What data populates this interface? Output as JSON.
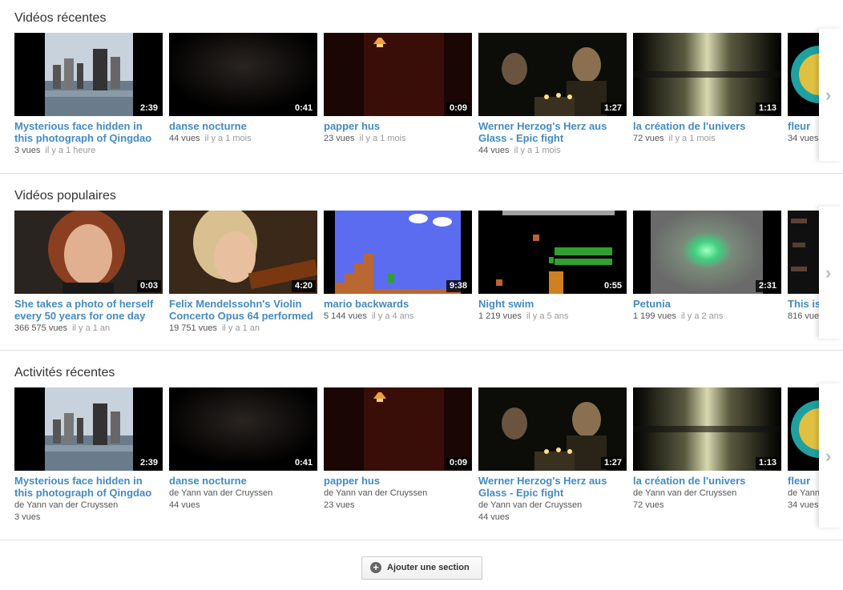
{
  "sections": [
    {
      "title": "Vidéos récentes",
      "videos": [
        {
          "title": "Mysterious face hidden in this photograph of Qingdao",
          "duration": "2:39",
          "views": "3 vues",
          "age": "il y a 1 heure"
        },
        {
          "title": "danse nocturne",
          "duration": "0:41",
          "views": "44 vues",
          "age": "il y a 1 mois"
        },
        {
          "title": "papper hus",
          "duration": "0:09",
          "views": "23 vues",
          "age": "il y a 1 mois"
        },
        {
          "title": "Werner Herzog's Herz aus Glass - Epic fight",
          "duration": "1:27",
          "views": "44 vues",
          "age": "il y a 1 mois"
        },
        {
          "title": "la création de l'univers",
          "duration": "1:13",
          "views": "72 vues",
          "age": "il y a 1 mois"
        },
        {
          "title": "fleur",
          "duration": "",
          "views": "34 vues",
          "age": ""
        }
      ]
    },
    {
      "title": "Vidéos populaires",
      "videos": [
        {
          "title": "She takes a photo of herself every 50 years for one day",
          "duration": "0:03",
          "views": "366 575 vues",
          "age": "il y a 1 an"
        },
        {
          "title": "Felix Mendelssohn's Violin Concerto Opus 64 performed",
          "duration": "4:20",
          "views": "19 751 vues",
          "age": "il y a 1 an"
        },
        {
          "title": "mario backwards",
          "duration": "9:38",
          "views": "5 144 vues",
          "age": "il y a 4 ans"
        },
        {
          "title": "Night swim",
          "duration": "0:55",
          "views": "1 219 vues",
          "age": "il y a 5 ans"
        },
        {
          "title": "Petunia",
          "duration": "2:31",
          "views": "1 199 vues",
          "age": "il y a 2 ans"
        },
        {
          "title": "This is",
          "duration": "",
          "views": "816 vue",
          "age": ""
        }
      ]
    },
    {
      "title": "Activités récentes",
      "videos": [
        {
          "title": "Mysterious face hidden in this photograph of Qingdao",
          "duration": "2:39",
          "author": "de Yann van der Cruyssen",
          "views": "3 vues"
        },
        {
          "title": "danse nocturne",
          "duration": "0:41",
          "author": "de Yann van der Cruyssen",
          "views": "44 vues"
        },
        {
          "title": "papper hus",
          "duration": "0:09",
          "author": "de Yann van der Cruyssen",
          "views": "23 vues"
        },
        {
          "title": "Werner Herzog's Herz aus Glass - Epic fight",
          "duration": "1:27",
          "author": "de Yann van der Cruyssen",
          "views": "44 vues"
        },
        {
          "title": "la création de l'univers",
          "duration": "1:13",
          "author": "de Yann van der Cruyssen",
          "views": "72 vues"
        },
        {
          "title": "fleur",
          "duration": "",
          "author": "de Yann",
          "views": "34 vues"
        }
      ]
    }
  ],
  "next_icon": "chevron-right-icon",
  "add_section": {
    "icon": "plus-circle-icon",
    "label": "Ajouter une section"
  },
  "colors": {
    "link": "#438bc5",
    "meta": "#555555",
    "age": "#999999"
  }
}
